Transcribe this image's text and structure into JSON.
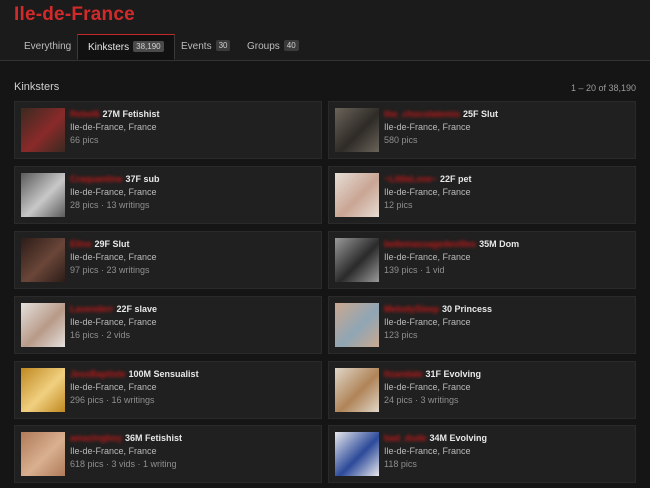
{
  "page_title": "Ile-de-France",
  "tabs": [
    {
      "label": "Everything",
      "count": ""
    },
    {
      "label": "Kinksters",
      "count": "38,190"
    },
    {
      "label": "Events",
      "count": "30"
    },
    {
      "label": "Groups",
      "count": "40"
    }
  ],
  "section": {
    "title": "Kinksters",
    "pagination": "1 – 20 of 38,190"
  },
  "location": "Ile-de-France, France",
  "users": [
    {
      "username": "Rebel6",
      "meta": "27M Fetishist",
      "stats": "66 pics",
      "thumb": [
        "#3a2a20",
        "#8a2a2a"
      ]
    },
    {
      "username": "the_chocolatemix",
      "meta": "25F Slut",
      "stats": "580 pics",
      "thumb": [
        "#6a645a",
        "#2e2a26"
      ]
    },
    {
      "username": "Craquantine",
      "meta": "37F sub",
      "stats": "28 pics · 13 writings",
      "thumb": [
        "#5a5a5a",
        "#c8c8c8"
      ]
    },
    {
      "username": "~LittleLove~",
      "meta": "22F pet",
      "stats": "12 pics",
      "thumb": [
        "#e6ddd4",
        "#c9a594"
      ]
    },
    {
      "username": "Eline",
      "meta": "29F Slut",
      "stats": "97 pics · 23 writings",
      "thumb": [
        "#2c1c18",
        "#6a4638"
      ]
    },
    {
      "username": "bellemassagedevilles",
      "meta": "35M Dom",
      "stats": "139 pics · 1 vid",
      "thumb": [
        "#9a9a9a",
        "#2a2a2a"
      ]
    },
    {
      "username": "Lavenderr",
      "meta": "22F slave",
      "stats": "16 pics · 2 vids",
      "thumb": [
        "#e4e0dc",
        "#b89a88"
      ]
    },
    {
      "username": "MelodySleep",
      "meta": "30 Princess",
      "stats": "123 pics",
      "thumb": [
        "#caa890",
        "#8fa6b4"
      ]
    },
    {
      "username": "JessBaptiste",
      "meta": "100M Sensualist",
      "stats": "296 pics · 16 writings",
      "thumb": [
        "#c08820",
        "#f0d080"
      ]
    },
    {
      "username": "Itzandale",
      "meta": "31F Evolving",
      "stats": "24 pics · 3 writings",
      "thumb": [
        "#e0d6c8",
        "#b08458"
      ]
    },
    {
      "username": "amazingboy",
      "meta": "36M Fetishist",
      "stats": "618 pics · 3 vids · 1 writing",
      "thumb": [
        "#b07a58",
        "#d8b090"
      ]
    },
    {
      "username": "bad_dude",
      "meta": "34M Evolving",
      "stats": "118 pics",
      "thumb": [
        "#e8e8ec",
        "#2c4a9a"
      ]
    }
  ]
}
